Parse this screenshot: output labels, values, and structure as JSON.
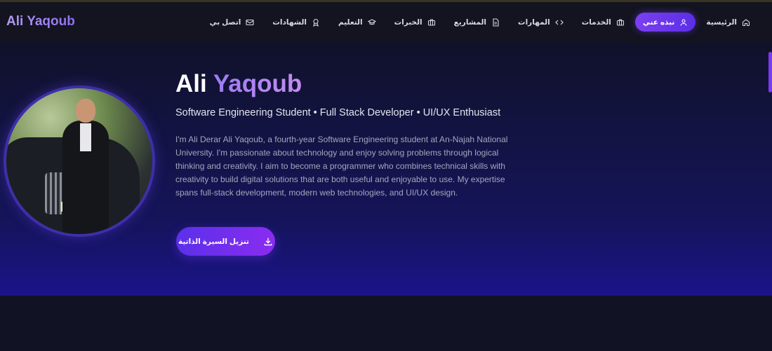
{
  "brand": {
    "name": "Ali Yaqoub",
    "color": "#9b7cf4"
  },
  "nav": {
    "items": [
      {
        "label": "الرئيسية",
        "icon": "home-icon"
      },
      {
        "label": "نبذه عني",
        "icon": "user-icon",
        "active": true
      },
      {
        "label": "الخدمات",
        "icon": "briefcase-icon"
      },
      {
        "label": "المهارات",
        "icon": "code-icon"
      },
      {
        "label": "المشاريع",
        "icon": "file-icon"
      },
      {
        "label": "الخبرات",
        "icon": "briefcase-icon"
      },
      {
        "label": "التعليم",
        "icon": "graduation-cap-icon"
      },
      {
        "label": "الشهادات",
        "icon": "award-icon"
      },
      {
        "label": "اتصل بي",
        "icon": "mail-icon"
      }
    ]
  },
  "hero": {
    "first_name": "Ali",
    "last_name": "Yaqoub",
    "subtitle": "Software Engineering Student • Full Stack Developer • UI/UX Enthusiast",
    "bio": "I'm Ali Derar Ali Yaqoub, a fourth-year Software Engineering student at An-Najah National University. I'm passionate about technology and enjoy solving problems through logical thinking and creativity. I aim to become a programmer who combines technical skills with creativity to build digital solutions that are both useful and enjoyable to use. My expertise spans full-stack development, modern web technologies, and UI/UX design.",
    "cv_button_label": "تنزيل السيرة الذاتية",
    "cv_button_icon": "download-icon"
  },
  "colors": {
    "accent": "#7b3ff0",
    "background": "#111223",
    "hero_bottom": "#1a148a"
  }
}
